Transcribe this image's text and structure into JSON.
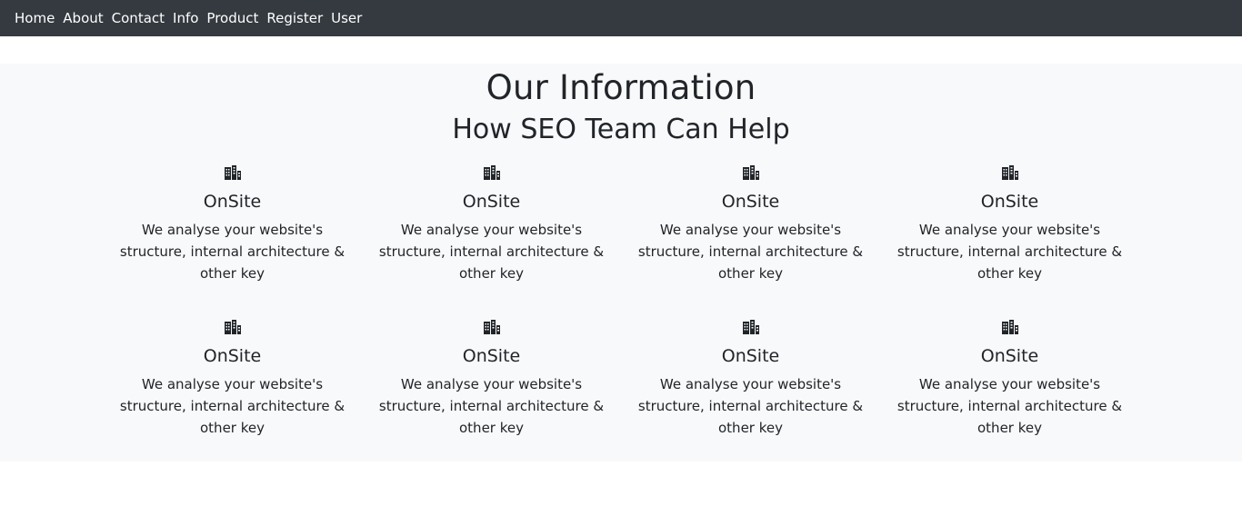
{
  "nav": {
    "items": [
      {
        "label": "Home"
      },
      {
        "label": "About"
      },
      {
        "label": "Contact"
      },
      {
        "label": "Info"
      },
      {
        "label": "Product"
      },
      {
        "label": "Register"
      },
      {
        "label": "User"
      }
    ]
  },
  "section": {
    "title": "Our Information",
    "subtitle": "How SEO Team Can Help",
    "cards": [
      {
        "icon": "building-icon",
        "title": "OnSite",
        "text": "We analyse your website's structure, internal architecture & other key"
      },
      {
        "icon": "building-icon",
        "title": "OnSite",
        "text": "We analyse your website's structure, internal architecture & other key"
      },
      {
        "icon": "building-icon",
        "title": "OnSite",
        "text": "We analyse your website's structure, internal architecture & other key"
      },
      {
        "icon": "building-icon",
        "title": "OnSite",
        "text": "We analyse your website's structure, internal architecture & other key"
      },
      {
        "icon": "building-icon",
        "title": "OnSite",
        "text": "We analyse your website's structure, internal architecture & other key"
      },
      {
        "icon": "building-icon",
        "title": "OnSite",
        "text": "We analyse your website's structure, internal architecture & other key"
      },
      {
        "icon": "building-icon",
        "title": "OnSite",
        "text": "We analyse your website's structure, internal architecture & other key"
      },
      {
        "icon": "building-icon",
        "title": "OnSite",
        "text": "We analyse your website's structure, internal architecture & other key"
      }
    ]
  },
  "colors": {
    "navbar_bg": "#343a40",
    "section_bg": "#f8f9fa",
    "text": "#212529"
  }
}
